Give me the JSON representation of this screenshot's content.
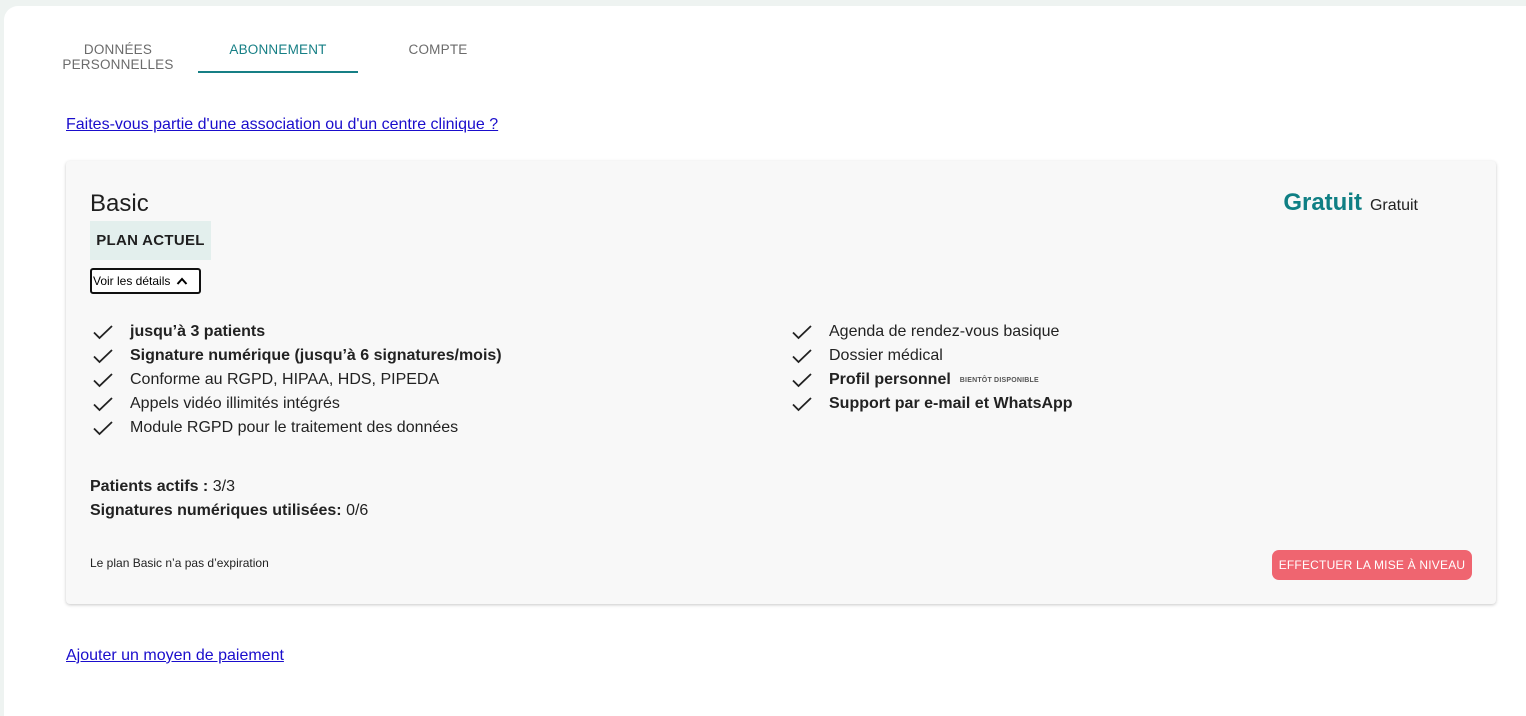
{
  "tabs": [
    {
      "label": "DONNÉES PERSONNELLES",
      "active": false
    },
    {
      "label": "ABONNEMENT",
      "active": true
    },
    {
      "label": "COMPTE",
      "active": false
    }
  ],
  "association_link": "Faites-vous partie d'une association ou d'un centre clinique ?",
  "plan": {
    "name": "Basic",
    "badge": "PLAN ACTUEL",
    "details_button": "Voir les détails",
    "price_main": "Gratuit",
    "price_sub": "Gratuit",
    "features_left": [
      {
        "text": "jusqu’à 3 patients",
        "bold": true
      },
      {
        "text": "Signature numérique (jusqu’à 6 signatures/mois)",
        "bold": true
      },
      {
        "text": "Conforme au RGPD, HIPAA, HDS, PIPEDA",
        "bold": false
      },
      {
        "text": "Appels vidéo illimités intégrés",
        "bold": false
      },
      {
        "text": "Module RGPD pour le traitement des données",
        "bold": false
      }
    ],
    "features_right": [
      {
        "text": "Agenda de rendez-vous basique",
        "bold": false
      },
      {
        "text": "Dossier médical",
        "bold": false
      },
      {
        "text": "Profil personnel",
        "bold": true,
        "tag": "BIENTÔT DISPONIBLE"
      },
      {
        "text": "Support par e-mail et WhatsApp",
        "bold": true
      }
    ],
    "stats": {
      "active_patients_label": "Patients actifs :",
      "active_patients_value": "3/3",
      "signatures_label": "Signatures numériques utilisées:",
      "signatures_value": "0/6"
    },
    "expiration_note": "Le plan Basic n’a pas d’expiration",
    "upgrade_button": "EFFECTUER LA MISE À NIVEAU"
  },
  "payment_link": "Ajouter un moyen de paiement",
  "colors": {
    "accent": "#167f85",
    "upgrade": "#ef6570",
    "link": "#1a0dcc",
    "badge_bg": "#e3efed"
  }
}
